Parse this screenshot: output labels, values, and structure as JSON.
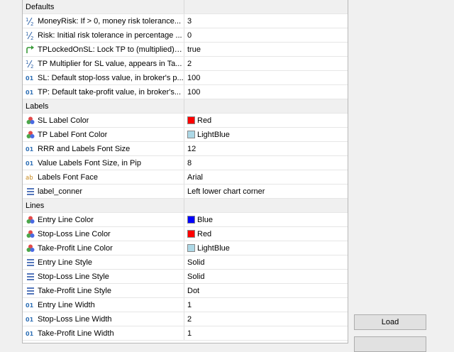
{
  "sections": [
    {
      "title": "Defaults",
      "rows": [
        {
          "icon": "half",
          "name": "MoneyRisk: If > 0, money risk tolerance...",
          "value": "3"
        },
        {
          "icon": "half",
          "name": "Risk: Initial risk tolerance in percentage ...",
          "value": "0"
        },
        {
          "icon": "bool",
          "name": "TPLockedOnSL: Lock TP to (multiplied) S...",
          "value": "true"
        },
        {
          "icon": "half",
          "name": "TP Multiplier for SL value, appears in Ta...",
          "value": "2"
        },
        {
          "icon": "int",
          "name": "SL: Default stop-loss value, in broker's p...",
          "value": "100"
        },
        {
          "icon": "int",
          "name": "TP: Default take-profit value, in broker's...",
          "value": "100"
        }
      ]
    },
    {
      "title": "Labels",
      "rows": [
        {
          "icon": "color",
          "name": "SL Label  Color",
          "value": "Red",
          "swatch": "#ff0000"
        },
        {
          "icon": "color",
          "name": "TP Label Font Color",
          "value": "LightBlue",
          "swatch": "#add8e6"
        },
        {
          "icon": "int",
          "name": "RRR and  Labels Font Size",
          "value": "12"
        },
        {
          "icon": "int",
          "name": "Value Labels Font Size, in Pip",
          "value": "8"
        },
        {
          "icon": "string",
          "name": "Labels Font Face",
          "value": "Arial"
        },
        {
          "icon": "enum",
          "name": "label_conner",
          "value": "Left lower chart corner"
        }
      ]
    },
    {
      "title": "Lines",
      "rows": [
        {
          "icon": "color",
          "name": "Entry Line Color",
          "value": "Blue",
          "swatch": "#0000ff"
        },
        {
          "icon": "color",
          "name": "Stop-Loss Line Color",
          "value": "Red",
          "swatch": "#ff0000"
        },
        {
          "icon": "color",
          "name": "Take-Profit Line Color",
          "value": "LightBlue",
          "swatch": "#add8e6"
        },
        {
          "icon": "enum",
          "name": "Entry Line Style",
          "value": "Solid"
        },
        {
          "icon": "enum",
          "name": "Stop-Loss Line Style",
          "value": "Solid"
        },
        {
          "icon": "enum",
          "name": "Take-Profit Line Style",
          "value": "Dot"
        },
        {
          "icon": "int",
          "name": "Entry Line Width",
          "value": "1"
        },
        {
          "icon": "int",
          "name": "Stop-Loss Line Width",
          "value": "2"
        },
        {
          "icon": "int",
          "name": "Take-Profit Line Width",
          "value": "1"
        }
      ]
    }
  ],
  "icons": {
    "half": "fraction-icon",
    "int": "integer-icon",
    "bool": "boolean-arrow-icon",
    "color": "palette-icon",
    "string": "string-ab-icon",
    "enum": "enum-list-icon"
  },
  "buttons": {
    "load": "Load"
  }
}
